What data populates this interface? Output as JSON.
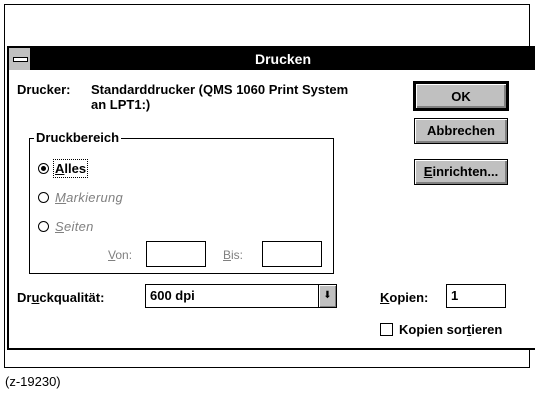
{
  "dialog": {
    "title": "Drucken",
    "printer_label": "Drucker:",
    "printer_value": "Standarddrucker (QMS 1060 Print System an LPT1:)"
  },
  "buttons": {
    "ok": "OK",
    "cancel": "Abbrechen",
    "setup_prefix": "E",
    "setup_rest": "inrichten..."
  },
  "range": {
    "group_title": "Druckbereich",
    "all": {
      "mnemonic": "A",
      "rest": "lles",
      "selected": true
    },
    "selection": {
      "mnemonic": "M",
      "rest": "arkierung",
      "enabled": false
    },
    "pages": {
      "mnemonic": "S",
      "rest": "eiten",
      "enabled": false
    },
    "from_mnemonic": "V",
    "from_rest": "on:",
    "to_mnemonic": "B",
    "to_rest": "is:"
  },
  "quality": {
    "label_pre": "Dr",
    "label_mnemonic": "u",
    "label_post": "ckqualität:",
    "value": "600 dpi",
    "arrow": "⬇"
  },
  "copies": {
    "label_mnemonic": "K",
    "label_rest": "opien:",
    "value": "1"
  },
  "collate": {
    "label_pre": "Kopien sor",
    "label_mnemonic": "t",
    "label_post": "ieren",
    "checked": false
  },
  "caption": "(z-19230)"
}
